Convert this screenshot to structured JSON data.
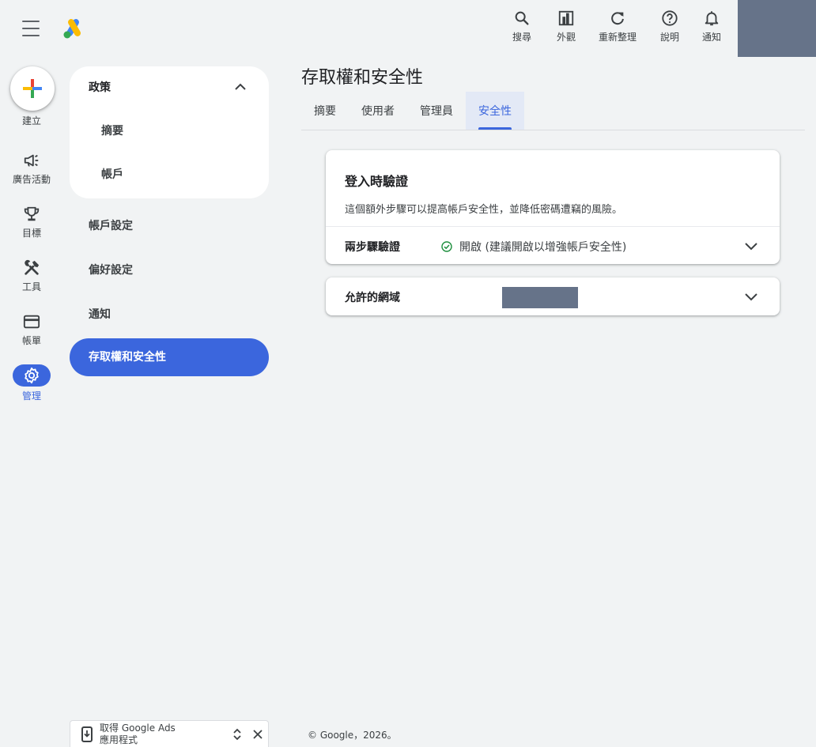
{
  "header": {
    "actions": [
      {
        "icon": "search-icon",
        "label": "搜尋"
      },
      {
        "icon": "appearance-icon",
        "label": "外觀"
      },
      {
        "icon": "refresh-icon",
        "label": "重新整理"
      },
      {
        "icon": "help-icon",
        "label": "說明"
      },
      {
        "icon": "bell-icon",
        "label": "通知"
      }
    ]
  },
  "rail": {
    "create_label": "建立",
    "items": [
      {
        "icon": "megaphone-icon",
        "label": "廣告活動"
      },
      {
        "icon": "trophy-icon",
        "label": "目標"
      },
      {
        "icon": "tools-icon",
        "label": "工具"
      },
      {
        "icon": "credit-card-icon",
        "label": "帳單"
      },
      {
        "icon": "gear-icon",
        "label": "管理",
        "active": true
      }
    ]
  },
  "subnav": {
    "policy_heading": "政策",
    "policy_items": [
      "摘要",
      "帳戶"
    ],
    "items": [
      "帳戶設定",
      "偏好設定",
      "通知"
    ],
    "active_item": "存取權和安全性"
  },
  "main": {
    "title": "存取權和安全性",
    "tabs": [
      {
        "label": "摘要"
      },
      {
        "label": "使用者"
      },
      {
        "label": "管理員"
      },
      {
        "label": "安全性",
        "active": true
      }
    ],
    "sign_in_card": {
      "title": "登入時驗證",
      "description": "這個額外步驟可以提高帳戶安全性，並降低密碼遭竊的風險。",
      "two_step_label": "兩步驟驗證",
      "two_step_status": "開啟 (建議開啟以增強帳戶安全性)"
    },
    "domains_card": {
      "label": "允許的網域"
    }
  },
  "footer": {
    "copyright": "© Google，2026。"
  },
  "app_promo": {
    "line1": "取得 Google Ads",
    "line2": "應用程式"
  },
  "colors": {
    "accent": "#3b66dd",
    "background": "#f1f3f4",
    "success": "#1e8e3e",
    "redaction": "#667389"
  }
}
